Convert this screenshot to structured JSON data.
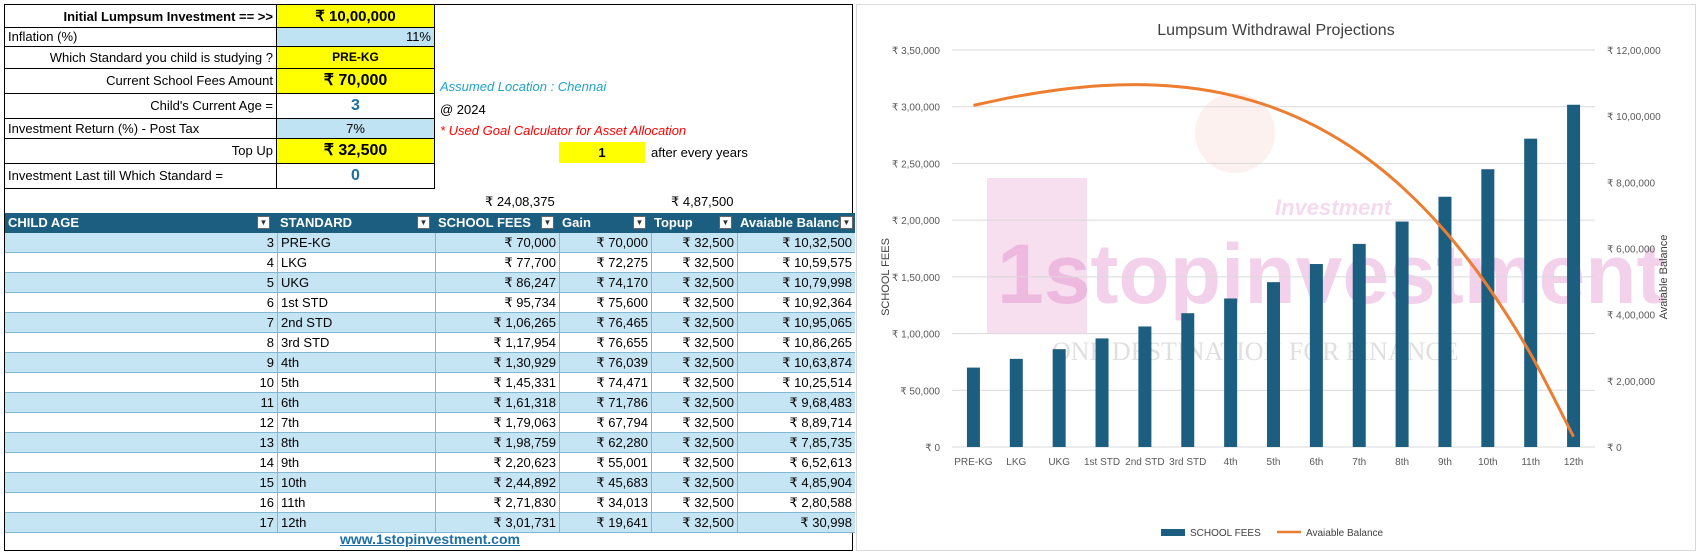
{
  "inputs": {
    "initial_label": "Initial Lumpsum Investment == >>",
    "initial_value": "₹ 10,00,000",
    "inflation_label": "Inflation (%)",
    "inflation_value": "11%",
    "standard_label": "Which Standard you child is studying ?",
    "standard_value": "PRE-KG",
    "fees_label": "Current School Fees Amount",
    "fees_value": "₹ 70,000",
    "age_label": "Child's Current Age =",
    "age_value": "3",
    "return_label": "Investment Return (%) - Post Tax",
    "return_value": "7%",
    "topup_label": "Top Up",
    "topup_value": "₹ 32,500",
    "last_label": "Investment Last till Which Standard =",
    "last_value": "0"
  },
  "notes": {
    "location": "Assumed Location : Chennai",
    "year": "@ 2024",
    "goal_calc": "* Used Goal Calculator for Asset Allocation",
    "every_value": "1",
    "every_label": "after every years"
  },
  "totals": {
    "fees_total": "₹ 24,08,375",
    "topup_total": "₹ 4,87,500"
  },
  "table": {
    "headers": [
      "CHILD AGE",
      "STANDARD",
      "SCHOOL FEES",
      "Gain",
      "Topup",
      "Avaiable Balance"
    ],
    "rows": [
      [
        "3",
        "PRE-KG",
        "₹ 70,000",
        "₹ 70,000",
        "₹ 32,500",
        "₹ 10,32,500"
      ],
      [
        "4",
        "LKG",
        "₹ 77,700",
        "₹ 72,275",
        "₹ 32,500",
        "₹ 10,59,575"
      ],
      [
        "5",
        "UKG",
        "₹ 86,247",
        "₹ 74,170",
        "₹ 32,500",
        "₹ 10,79,998"
      ],
      [
        "6",
        "1st STD",
        "₹ 95,734",
        "₹ 75,600",
        "₹ 32,500",
        "₹ 10,92,364"
      ],
      [
        "7",
        "2nd STD",
        "₹ 1,06,265",
        "₹ 76,465",
        "₹ 32,500",
        "₹ 10,95,065"
      ],
      [
        "8",
        "3rd STD",
        "₹ 1,17,954",
        "₹ 76,655",
        "₹ 32,500",
        "₹ 10,86,265"
      ],
      [
        "9",
        "4th",
        "₹ 1,30,929",
        "₹ 76,039",
        "₹ 32,500",
        "₹ 10,63,874"
      ],
      [
        "10",
        "5th",
        "₹ 1,45,331",
        "₹ 74,471",
        "₹ 32,500",
        "₹ 10,25,514"
      ],
      [
        "11",
        "6th",
        "₹ 1,61,318",
        "₹ 71,786",
        "₹ 32,500",
        "₹ 9,68,483"
      ],
      [
        "12",
        "7th",
        "₹ 1,79,063",
        "₹ 67,794",
        "₹ 32,500",
        "₹ 8,89,714"
      ],
      [
        "13",
        "8th",
        "₹ 1,98,759",
        "₹ 62,280",
        "₹ 32,500",
        "₹ 7,85,735"
      ],
      [
        "14",
        "9th",
        "₹ 2,20,623",
        "₹ 55,001",
        "₹ 32,500",
        "₹ 6,52,613"
      ],
      [
        "15",
        "10th",
        "₹ 2,44,892",
        "₹ 45,683",
        "₹ 32,500",
        "₹ 4,85,904"
      ],
      [
        "16",
        "11th",
        "₹ 2,71,830",
        "₹ 34,013",
        "₹ 32,500",
        "₹ 2,80,588"
      ],
      [
        "17",
        "12th",
        "₹ 3,01,731",
        "₹ 19,641",
        "₹ 32,500",
        "₹ 30,998"
      ]
    ]
  },
  "footer_link": "www.1stopinvestment.com",
  "watermark": {
    "brand": "1stopinvestment",
    "tagline": "ONE DESTINATION FOR FINANCE",
    "small": "Investment"
  },
  "colors": {
    "header_blue": "#1b5e80",
    "input_yellow": "#ffff00",
    "row_blue": "#c6e5f4",
    "bar": "#1b5e80",
    "line": "#ed7d31",
    "note_teal": "#20a3c8",
    "note_red": "#ff0000"
  },
  "chart_data": {
    "type": "bar",
    "title": "Lumpsum Withdrawal Projections",
    "categories": [
      "PRE-KG",
      "LKG",
      "UKG",
      "1st STD",
      "2nd STD",
      "3rd STD",
      "4th",
      "5th",
      "6th",
      "7th",
      "8th",
      "9th",
      "10th",
      "11th",
      "12th"
    ],
    "series": [
      {
        "name": "SCHOOL FEES",
        "type": "bar",
        "axis": "left",
        "color": "#1b5e80",
        "values": [
          70000,
          77700,
          86247,
          95734,
          106265,
          117954,
          130929,
          145331,
          161318,
          179063,
          198759,
          220623,
          244892,
          271830,
          301731
        ]
      },
      {
        "name": "Avaiable Balance",
        "type": "line",
        "axis": "right",
        "color": "#ed7d31",
        "values": [
          1032500,
          1059575,
          1079998,
          1092364,
          1095065,
          1086265,
          1063874,
          1025514,
          968483,
          889714,
          785735,
          652613,
          485904,
          280588,
          30998
        ]
      }
    ],
    "ylabel": "SCHOOL FEES",
    "y2label": "Avaiable Balance",
    "ylim": [
      0,
      350000
    ],
    "y2lim": [
      0,
      1200000
    ],
    "yticks": [
      "₹ 0",
      "₹ 50,000",
      "₹ 1,00,000",
      "₹ 1,50,000",
      "₹ 2,00,000",
      "₹ 2,50,000",
      "₹ 3,00,000",
      "₹ 3,50,000"
    ],
    "y2ticks": [
      "₹ 0",
      "₹ 2,00,000",
      "₹ 4,00,000",
      "₹ 6,00,000",
      "₹ 8,00,000",
      "₹ 10,00,000",
      "₹ 12,00,000"
    ],
    "grid": true,
    "legend": "bottom"
  }
}
